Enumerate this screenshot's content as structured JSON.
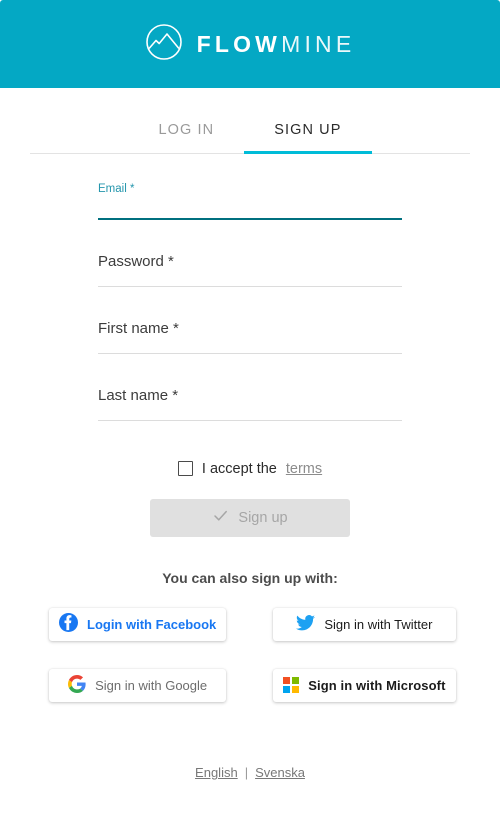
{
  "brand": {
    "logo_icon": "mountain-circle-icon",
    "name_bold": "FLOW",
    "name_light": "MINE",
    "header_color": "#04a8c4"
  },
  "tabs": [
    {
      "label": "LOG IN",
      "active": false
    },
    {
      "label": "SIGN UP",
      "active": true
    }
  ],
  "form": {
    "fields": [
      {
        "label": "Email",
        "required_mark": "*",
        "value": "",
        "focused": true
      },
      {
        "label": "Password",
        "required_mark": "*",
        "value": "",
        "focused": false
      },
      {
        "label": "First name",
        "required_mark": "*",
        "value": "",
        "focused": false
      },
      {
        "label": "Last name",
        "required_mark": "*",
        "value": "",
        "focused": false
      }
    ],
    "accept": {
      "checked": false,
      "text": "I accept the",
      "link_label": "terms"
    },
    "submit": {
      "label": "Sign up",
      "icon": "check-icon",
      "disabled": true
    }
  },
  "social": {
    "title": "You can also sign up with:",
    "buttons": [
      {
        "label": "Login with Facebook",
        "icon": "facebook-icon",
        "color": "#1877f2"
      },
      {
        "label": "Sign in with Twitter",
        "icon": "twitter-icon",
        "color": "#1da1f2"
      },
      {
        "label": "Sign in with Google",
        "icon": "google-icon",
        "color": "#4285f4"
      },
      {
        "label": "Sign in with Microsoft",
        "icon": "microsoft-icon",
        "color": "#f25022"
      }
    ]
  },
  "footer": {
    "languages": [
      {
        "label": "English"
      },
      {
        "label": "Svenska"
      }
    ],
    "separator": "|"
  },
  "colors": {
    "accent": "#04a8c4",
    "tab_underline": "#00bcd8",
    "focus_underline": "#00707f",
    "focus_label": "#2596ad"
  }
}
